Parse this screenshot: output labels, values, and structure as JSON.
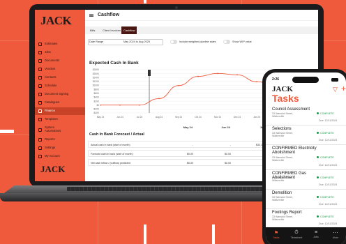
{
  "desktop": {
    "logo": "JACK",
    "page_title": "Cashflow",
    "sidebar": {
      "items": [
        {
          "label": "Estimates"
        },
        {
          "label": "Jobs"
        },
        {
          "label": "Documents"
        },
        {
          "label": "Vendors"
        },
        {
          "label": "Contacts"
        },
        {
          "label": "Schedule"
        },
        {
          "label": "Document Signing"
        },
        {
          "label": "Catalogues"
        },
        {
          "label": "Finance"
        },
        {
          "label": "Templates"
        },
        {
          "label": "System Automations"
        },
        {
          "label": "Reports"
        },
        {
          "label": "Settings"
        },
        {
          "label": "My Account"
        }
      ],
      "footer_logo": "JACK"
    },
    "tabs": [
      "Bills",
      "Client Invoices",
      "Cashflow"
    ],
    "filters": {
      "date_range_label": "Date Range",
      "date_range_value": "May 2024 to Aug 2025",
      "toggle1_label": "Include weighted pipeline sales",
      "toggle2_label": "Show WIP value"
    },
    "chart_section_title": "Expected Cash In Bank",
    "table": {
      "title": "Cash In Bank Forecast / Actual",
      "columns": [
        "May 24",
        "Jun 24",
        "Jul 24",
        "Aug 24"
      ],
      "rows": [
        {
          "label": "Actual cash in bank (start of month)",
          "values": [
            "-",
            "-",
            "$33,120.00",
            "-"
          ]
        },
        {
          "label": "Forecast cash in bank (start of month)",
          "values": [
            "$0.00",
            "$0.00",
            "$0.00",
            "$33,120.00"
          ]
        },
        {
          "label": "Net cash inflow / (outflow) predicted",
          "values": [
            "$0.00",
            "$0.00",
            "$0.00",
            "$66,210.00"
          ]
        }
      ]
    }
  },
  "chart_data": {
    "type": "line",
    "title": "Expected Cash In Bank",
    "x": [
      "May 24",
      "Jun 24",
      "Jul 24",
      "Aug 24",
      "Sep 24",
      "Oct 24",
      "Nov 24",
      "Dec 24",
      "Jan 25",
      "Feb 25",
      "Mar 25",
      "Apr 25"
    ],
    "series": [
      {
        "values": [
          0,
          0,
          0,
          33120,
          99330,
          146000,
          161000,
          154000,
          119000,
          99000,
          93000,
          99000
        ],
        "color": "#ef5a3c"
      }
    ],
    "yticks": [
      "$180K",
      "$160K",
      "$140K",
      "$120K",
      "$100K",
      "$80K",
      "$60K",
      "$40K",
      "$20K",
      "$0",
      "-$20K",
      "-$40K"
    ],
    "ylim": [
      -40000,
      180000
    ],
    "grid": true
  },
  "mobile": {
    "time": "2:26",
    "logo": "JACK",
    "title": "Tasks",
    "tasks": [
      {
        "name": "Council Assessment",
        "address": "33 Warwick Street, Walkerville",
        "status": "COMPLETE",
        "due": "Due: 12/11/2024"
      },
      {
        "name": "Selections",
        "address": "33 Warwick Street, Walkerville",
        "status": "COMPLETE",
        "due": "Due: 12/11/2024"
      },
      {
        "name": "CONFIRMED Electricity Abolishment",
        "address": "33 Warwick Street, Walkerville",
        "status": "COMPLETE",
        "due": "Due: 12/11/2024"
      },
      {
        "name": "CONFIRMED Gas Abolishment",
        "address": "33 Warwick Street, Walkerville",
        "status": "COMPLETE",
        "due": "Due: 12/11/2024"
      },
      {
        "name": "Demolition",
        "address": "33 Warwick Street, Walkerville",
        "status": "COMPLETE",
        "due": "Due: 12/11/2024"
      },
      {
        "name": "Footings Report",
        "address": "33 Warwick Street, Walkerville",
        "status": "COMPLETE",
        "due": "Due: 12/11/2024"
      }
    ],
    "nav": [
      {
        "label": "Tasks",
        "icon": "flag-icon"
      },
      {
        "label": "Timesheet",
        "icon": "stopwatch-icon"
      },
      {
        "label": "Jobs",
        "icon": "list-icon"
      },
      {
        "label": "More",
        "icon": "more-icon"
      }
    ]
  },
  "colors": {
    "brand": "#ef5a3c",
    "dark_tab": "#4a1612",
    "complete": "#1c9a4a"
  }
}
